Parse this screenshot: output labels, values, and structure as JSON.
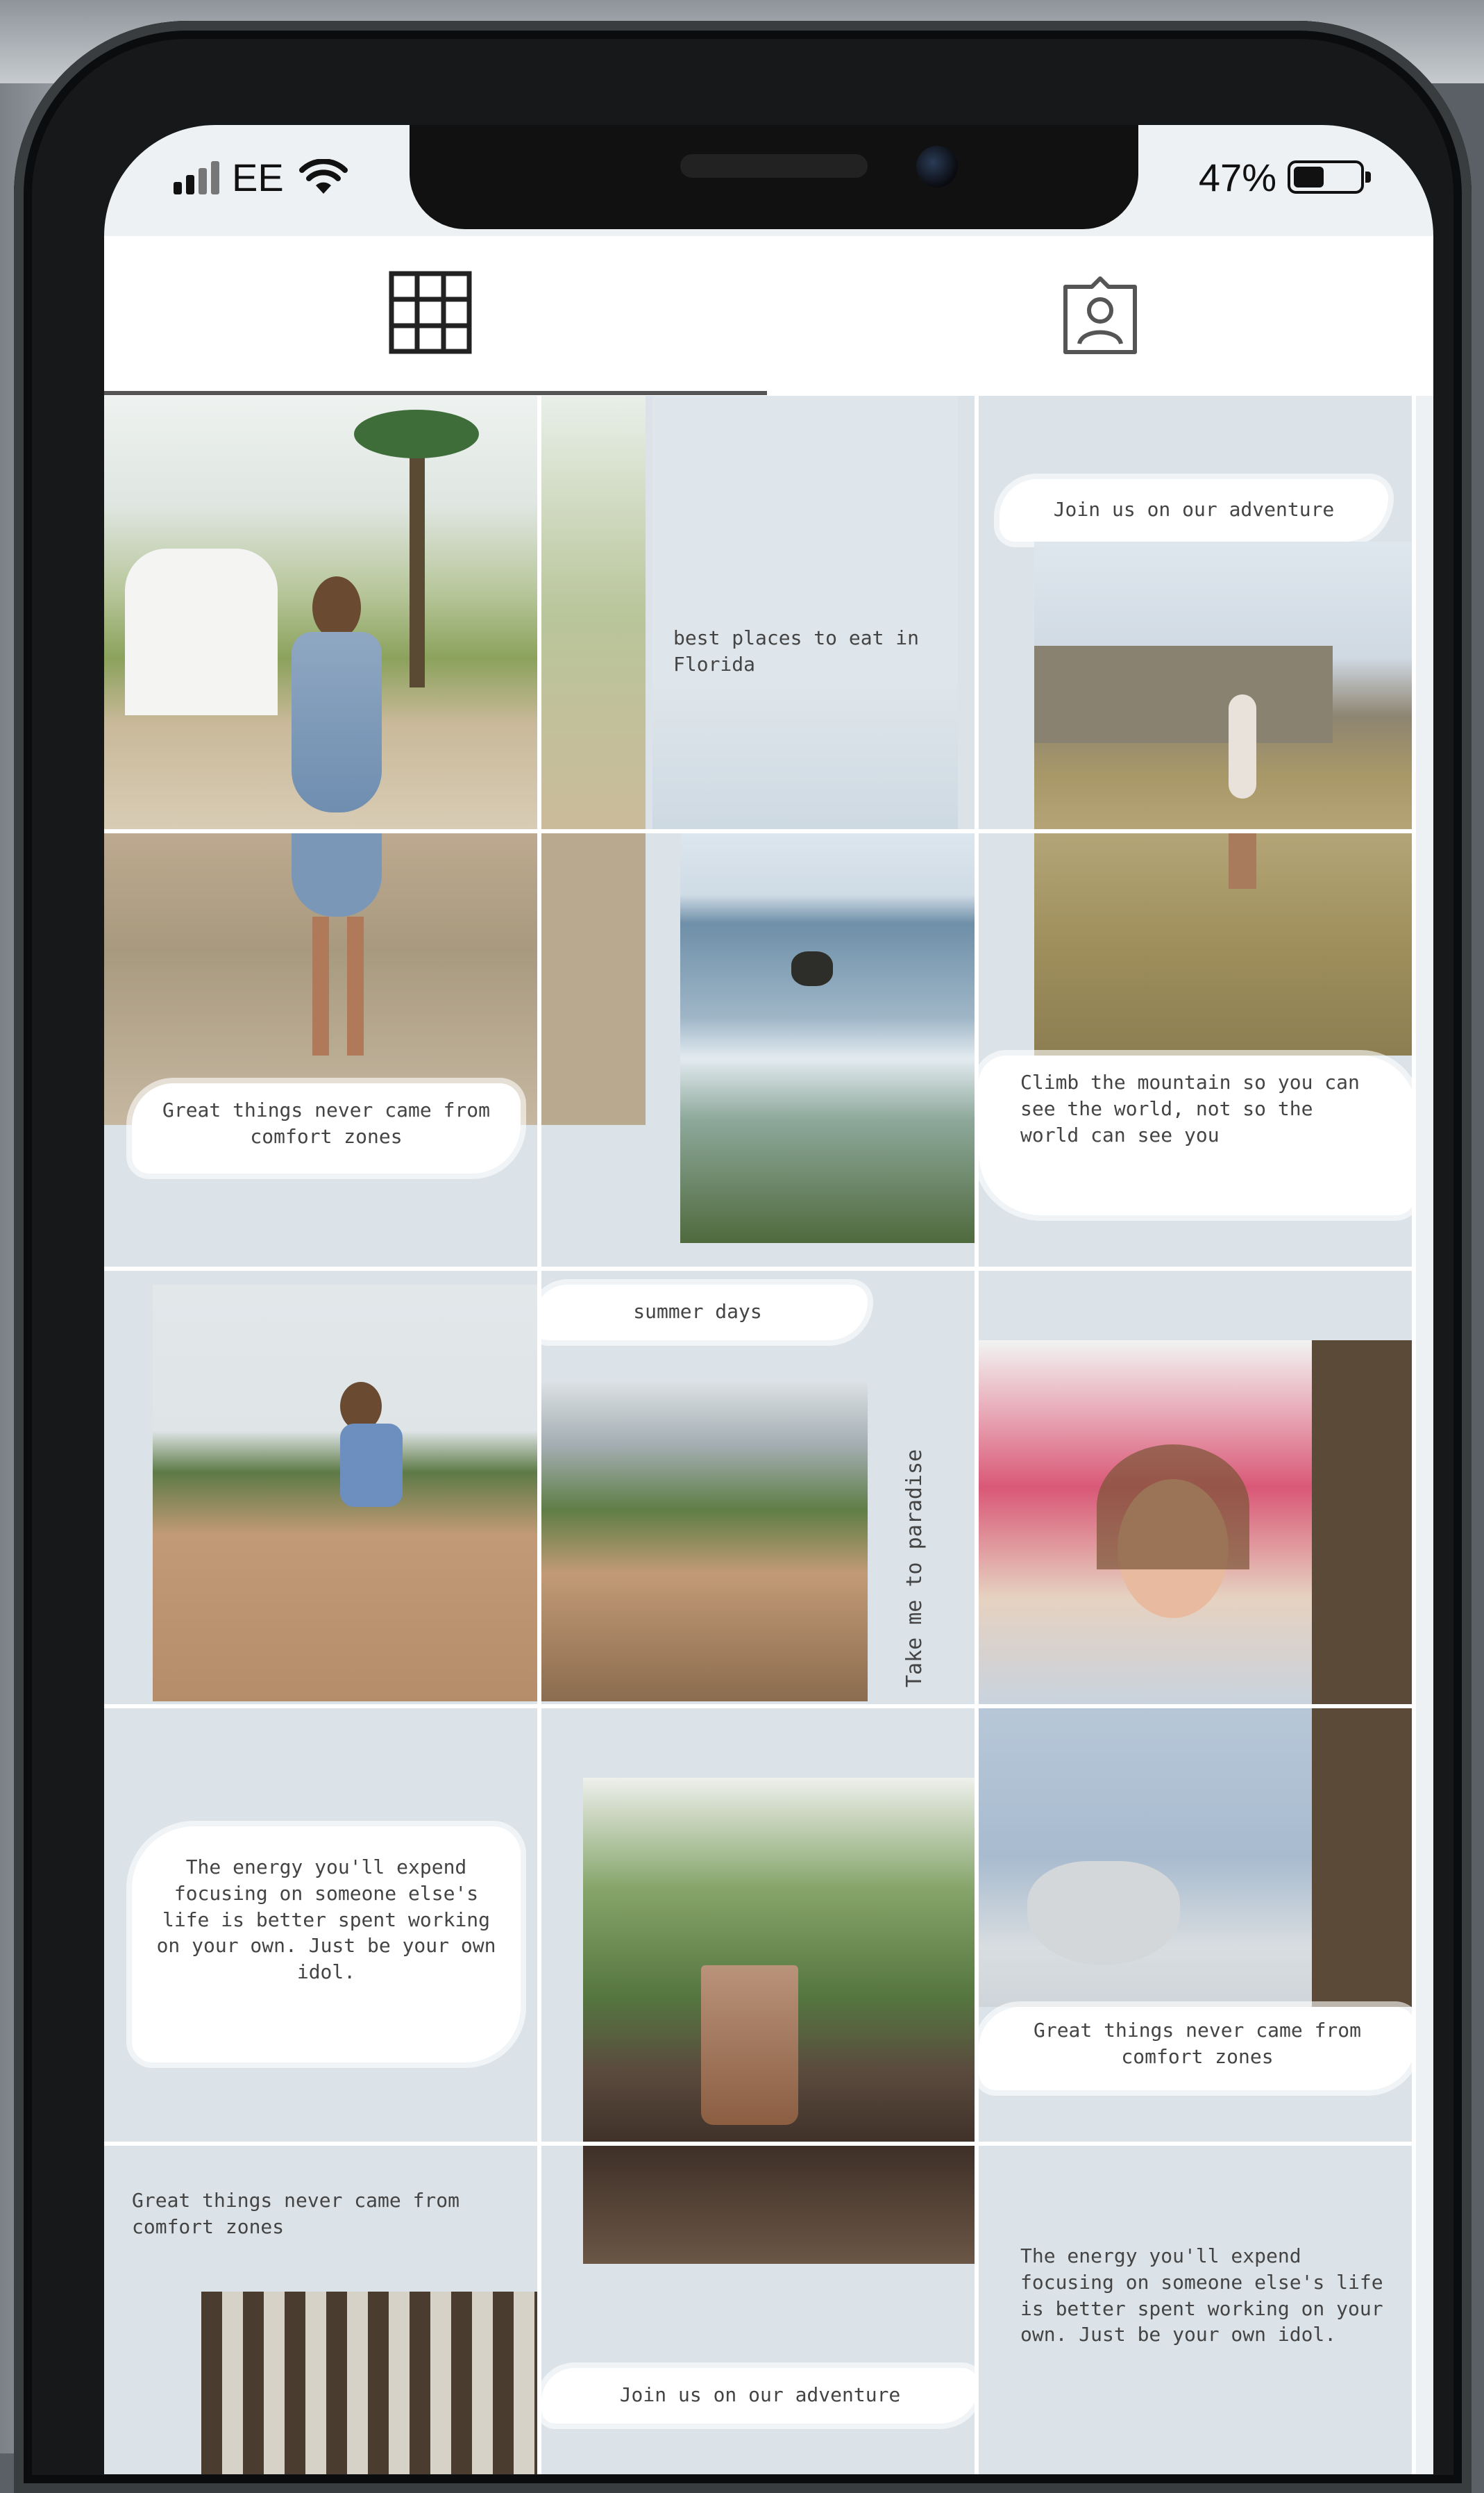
{
  "status_bar": {
    "carrier": "EE",
    "battery_percent": "47%",
    "battery_level": 0.47
  },
  "tabs": [
    {
      "icon": "grid-icon",
      "active": true
    },
    {
      "icon": "tagged-person-icon",
      "active": false
    }
  ],
  "captions": {
    "c1": "Great things never came from comfort zones",
    "c2": "best places to eat in Florida",
    "c3": "Join us on our adventure",
    "c4": "Climb the mountain so you can see the world, not so the world can see you",
    "c5": "summer days",
    "c6": "Take me to paradise",
    "c7": "The energy you'll expend focusing on someone else's life is better spent working on your own. Just be your own idol.",
    "c8": "Great things never came from comfort zones",
    "c9": "Great things never came from comfort zones",
    "c10": "The energy you'll expend focusing on someone else's life is better spent working on your own. Just be your own idol.",
    "c11": "Join us on our adventure"
  },
  "colors": {
    "tile_bg": "#dce3e8",
    "brush": "#ffffff",
    "text": "#444444"
  }
}
